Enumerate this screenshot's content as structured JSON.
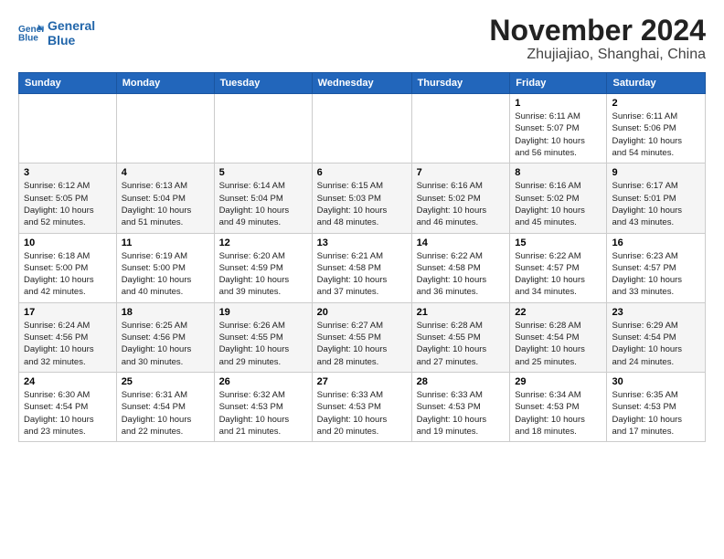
{
  "header": {
    "logo_line1": "General",
    "logo_line2": "Blue",
    "title": "November 2024",
    "subtitle": "Zhujiajiao, Shanghai, China"
  },
  "days_of_week": [
    "Sunday",
    "Monday",
    "Tuesday",
    "Wednesday",
    "Thursday",
    "Friday",
    "Saturday"
  ],
  "weeks": [
    {
      "days": [
        {
          "num": "",
          "info": ""
        },
        {
          "num": "",
          "info": ""
        },
        {
          "num": "",
          "info": ""
        },
        {
          "num": "",
          "info": ""
        },
        {
          "num": "",
          "info": ""
        },
        {
          "num": "1",
          "info": "Sunrise: 6:11 AM\nSunset: 5:07 PM\nDaylight: 10 hours\nand 56 minutes."
        },
        {
          "num": "2",
          "info": "Sunrise: 6:11 AM\nSunset: 5:06 PM\nDaylight: 10 hours\nand 54 minutes."
        }
      ]
    },
    {
      "days": [
        {
          "num": "3",
          "info": "Sunrise: 6:12 AM\nSunset: 5:05 PM\nDaylight: 10 hours\nand 52 minutes."
        },
        {
          "num": "4",
          "info": "Sunrise: 6:13 AM\nSunset: 5:04 PM\nDaylight: 10 hours\nand 51 minutes."
        },
        {
          "num": "5",
          "info": "Sunrise: 6:14 AM\nSunset: 5:04 PM\nDaylight: 10 hours\nand 49 minutes."
        },
        {
          "num": "6",
          "info": "Sunrise: 6:15 AM\nSunset: 5:03 PM\nDaylight: 10 hours\nand 48 minutes."
        },
        {
          "num": "7",
          "info": "Sunrise: 6:16 AM\nSunset: 5:02 PM\nDaylight: 10 hours\nand 46 minutes."
        },
        {
          "num": "8",
          "info": "Sunrise: 6:16 AM\nSunset: 5:02 PM\nDaylight: 10 hours\nand 45 minutes."
        },
        {
          "num": "9",
          "info": "Sunrise: 6:17 AM\nSunset: 5:01 PM\nDaylight: 10 hours\nand 43 minutes."
        }
      ]
    },
    {
      "days": [
        {
          "num": "10",
          "info": "Sunrise: 6:18 AM\nSunset: 5:00 PM\nDaylight: 10 hours\nand 42 minutes."
        },
        {
          "num": "11",
          "info": "Sunrise: 6:19 AM\nSunset: 5:00 PM\nDaylight: 10 hours\nand 40 minutes."
        },
        {
          "num": "12",
          "info": "Sunrise: 6:20 AM\nSunset: 4:59 PM\nDaylight: 10 hours\nand 39 minutes."
        },
        {
          "num": "13",
          "info": "Sunrise: 6:21 AM\nSunset: 4:58 PM\nDaylight: 10 hours\nand 37 minutes."
        },
        {
          "num": "14",
          "info": "Sunrise: 6:22 AM\nSunset: 4:58 PM\nDaylight: 10 hours\nand 36 minutes."
        },
        {
          "num": "15",
          "info": "Sunrise: 6:22 AM\nSunset: 4:57 PM\nDaylight: 10 hours\nand 34 minutes."
        },
        {
          "num": "16",
          "info": "Sunrise: 6:23 AM\nSunset: 4:57 PM\nDaylight: 10 hours\nand 33 minutes."
        }
      ]
    },
    {
      "days": [
        {
          "num": "17",
          "info": "Sunrise: 6:24 AM\nSunset: 4:56 PM\nDaylight: 10 hours\nand 32 minutes."
        },
        {
          "num": "18",
          "info": "Sunrise: 6:25 AM\nSunset: 4:56 PM\nDaylight: 10 hours\nand 30 minutes."
        },
        {
          "num": "19",
          "info": "Sunrise: 6:26 AM\nSunset: 4:55 PM\nDaylight: 10 hours\nand 29 minutes."
        },
        {
          "num": "20",
          "info": "Sunrise: 6:27 AM\nSunset: 4:55 PM\nDaylight: 10 hours\nand 28 minutes."
        },
        {
          "num": "21",
          "info": "Sunrise: 6:28 AM\nSunset: 4:55 PM\nDaylight: 10 hours\nand 27 minutes."
        },
        {
          "num": "22",
          "info": "Sunrise: 6:28 AM\nSunset: 4:54 PM\nDaylight: 10 hours\nand 25 minutes."
        },
        {
          "num": "23",
          "info": "Sunrise: 6:29 AM\nSunset: 4:54 PM\nDaylight: 10 hours\nand 24 minutes."
        }
      ]
    },
    {
      "days": [
        {
          "num": "24",
          "info": "Sunrise: 6:30 AM\nSunset: 4:54 PM\nDaylight: 10 hours\nand 23 minutes."
        },
        {
          "num": "25",
          "info": "Sunrise: 6:31 AM\nSunset: 4:54 PM\nDaylight: 10 hours\nand 22 minutes."
        },
        {
          "num": "26",
          "info": "Sunrise: 6:32 AM\nSunset: 4:53 PM\nDaylight: 10 hours\nand 21 minutes."
        },
        {
          "num": "27",
          "info": "Sunrise: 6:33 AM\nSunset: 4:53 PM\nDaylight: 10 hours\nand 20 minutes."
        },
        {
          "num": "28",
          "info": "Sunrise: 6:33 AM\nSunset: 4:53 PM\nDaylight: 10 hours\nand 19 minutes."
        },
        {
          "num": "29",
          "info": "Sunrise: 6:34 AM\nSunset: 4:53 PM\nDaylight: 10 hours\nand 18 minutes."
        },
        {
          "num": "30",
          "info": "Sunrise: 6:35 AM\nSunset: 4:53 PM\nDaylight: 10 hours\nand 17 minutes."
        }
      ]
    }
  ]
}
